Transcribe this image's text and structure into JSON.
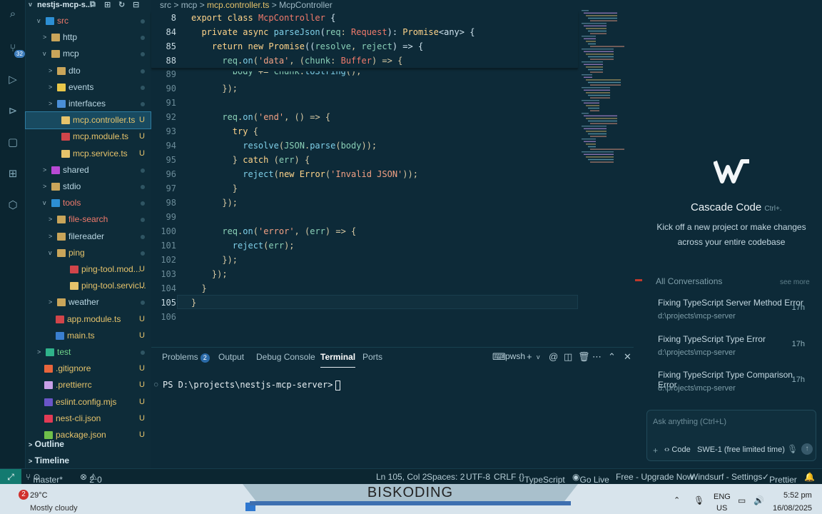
{
  "explorer": {
    "project": "nestjs-mcp-s...",
    "items": [
      {
        "label": "src",
        "status": "",
        "chev": "v",
        "color": "#f07a6b",
        "icon": "#2d8fd4"
      },
      {
        "label": "http",
        "status": "",
        "chev": ">",
        "color": "#b9d6e2",
        "icon": "#c9a55a"
      },
      {
        "label": "mcp",
        "status": "",
        "chev": "v",
        "color": "#b9d6e2",
        "icon": "#c9a55a"
      },
      {
        "label": "dto",
        "status": "",
        "chev": ">",
        "color": "#b9d6e2",
        "icon": "#c9a55a"
      },
      {
        "label": "events",
        "status": "",
        "chev": ">",
        "color": "#b9d6e2",
        "icon": "#e8c74a"
      },
      {
        "label": "interfaces",
        "status": "",
        "chev": ">",
        "color": "#b9d6e2",
        "icon": "#4a8fd8"
      },
      {
        "label": "mcp.controller.ts",
        "status": "U",
        "chev": "",
        "color": "#e6c36b",
        "icon": "#e6c36b",
        "selected": true
      },
      {
        "label": "mcp.module.ts",
        "status": "U",
        "chev": "",
        "color": "#e6c36b",
        "icon": "#d1454a"
      },
      {
        "label": "mcp.service.ts",
        "status": "U",
        "chev": "",
        "color": "#e6c36b",
        "icon": "#e6c36b"
      },
      {
        "label": "shared",
        "status": "",
        "chev": ">",
        "color": "#b9d6e2",
        "icon": "#b84ad4"
      },
      {
        "label": "stdio",
        "status": "",
        "chev": ">",
        "color": "#b9d6e2",
        "icon": "#c9a55a"
      },
      {
        "label": "tools",
        "status": "",
        "chev": "v",
        "color": "#f07a6b",
        "icon": "#2d8fd4"
      },
      {
        "label": "file-search",
        "status": "",
        "chev": ">",
        "color": "#f07a6b",
        "icon": "#c9a55a"
      },
      {
        "label": "filereader",
        "status": "",
        "chev": ">",
        "color": "#b9d6e2",
        "icon": "#c9a55a"
      },
      {
        "label": "ping",
        "status": "",
        "chev": "v",
        "color": "#e6c36b",
        "icon": "#c9a55a"
      },
      {
        "label": "ping-tool.mod...",
        "status": "U",
        "chev": "",
        "color": "#e6c36b",
        "icon": "#d1454a"
      },
      {
        "label": "ping-tool.servic...",
        "status": "U",
        "chev": "",
        "color": "#e6c36b",
        "icon": "#e6c36b"
      },
      {
        "label": "weather",
        "status": "",
        "chev": ">",
        "color": "#b9d6e2",
        "icon": "#c9a55a"
      },
      {
        "label": "app.module.ts",
        "status": "U",
        "chev": "",
        "color": "#e6c36b",
        "icon": "#d1454a"
      },
      {
        "label": "main.ts",
        "status": "U",
        "chev": "",
        "color": "#e6c36b",
        "icon": "#3a7fcf"
      },
      {
        "label": "test",
        "status": "",
        "chev": ">",
        "color": "#6fd48a",
        "icon": "#2fb38a"
      },
      {
        "label": ".gitignore",
        "status": "U",
        "chev": "",
        "color": "#e6c36b",
        "icon": "#e8653c"
      },
      {
        "label": ".prettierrc",
        "status": "U",
        "chev": "",
        "color": "#e6c36b",
        "icon": "#c8a0e8"
      },
      {
        "label": "eslint.config.mjs",
        "status": "U",
        "chev": "",
        "color": "#e6c36b",
        "icon": "#6a55c8"
      },
      {
        "label": "nest-cli.json",
        "status": "U",
        "chev": "",
        "color": "#e6c36b",
        "icon": "#e23b55"
      },
      {
        "label": "package.json",
        "status": "U",
        "chev": "",
        "color": "#e6c36b",
        "icon": "#6fbf4a"
      }
    ],
    "outline": "Outline",
    "timeline": "Timeline"
  },
  "breadcrumb": {
    "parts": [
      "src",
      "mcp",
      "mcp.controller.ts",
      "McpController"
    ],
    "sep": ">"
  },
  "code": [
    {
      "n": "8",
      "html": "<span class='kw'>export</span> <span class='kw'>class</span> <span class='cls'>McpController</span> <span class='pl'>{</span>",
      "sticky": true
    },
    {
      "n": "84",
      "html": "  <span class='kw'>private</span> <span class='kw'>async</span> <span class='fn'>parseJson</span><span class='pl'>(</span><span class='pm'>req</span>: <span class='cls'>Request</span><span class='pl'>):</span> <span class='kw'>Promise</span><span class='pl'>&lt;any&gt; {</span>",
      "sticky": true
    },
    {
      "n": "85",
      "html": "    <span class='kw'>return</span> <span class='kw'>new</span> <span class='kw'>Promise</span><span class='pl'>((</span><span class='pm'>resolve</span>, <span class='pm'>reject</span><span class='pl'>) =&gt; {</span>",
      "sticky": true
    },
    {
      "n": "88",
      "html": "      <span class='pm'>req</span>.<span class='fn'>on</span>(<span class='st2'>'data'</span>, (<span class='pm'>chunk</span>: <span class='cls'>Buffer</span>) =&gt; {",
      "sticky": true
    },
    {
      "n": "89",
      "html": "        <span class='pm'>body</span> += <span class='pm'>chunk</span>.<span class='fn'>toString</span>();"
    },
    {
      "n": "90",
      "html": "      });"
    },
    {
      "n": "91",
      "html": ""
    },
    {
      "n": "92",
      "html": "      <span class='pm'>req</span>.<span class='fn'>on</span>(<span class='st2'>'end'</span>, () =&gt; {"
    },
    {
      "n": "93",
      "html": "        <span class='kw'>try</span> {"
    },
    {
      "n": "94",
      "html": "          <span class='fn'>resolve</span>(<span class='pm'>JSON</span>.<span class='fn'>parse</span>(<span class='pm'>body</span>));"
    },
    {
      "n": "95",
      "html": "        } <span class='kw'>catch</span> (<span class='pm'>err</span>) {"
    },
    {
      "n": "96",
      "html": "          <span class='fn'>reject</span>(<span class='kw'>new</span> <span class='kw'>Error</span>(<span class='st2'>'Invalid JSON'</span>));"
    },
    {
      "n": "97",
      "html": "        }"
    },
    {
      "n": "98",
      "html": "      });"
    },
    {
      "n": "99",
      "html": ""
    },
    {
      "n": "100",
      "html": "      <span class='pm'>req</span>.<span class='fn'>on</span>(<span class='st2'>'error'</span>, (<span class='pm'>err</span>) =&gt; {"
    },
    {
      "n": "101",
      "html": "        <span class='fn'>reject</span>(<span class='pm'>err</span>);"
    },
    {
      "n": "102",
      "html": "      });"
    },
    {
      "n": "103",
      "html": "    });"
    },
    {
      "n": "104",
      "html": "  }"
    },
    {
      "n": "105",
      "html": "}"
    },
    {
      "n": "106",
      "html": ""
    }
  ],
  "panel": {
    "tabs": [
      "Problems",
      "Output",
      "Debug Console",
      "Terminal",
      "Ports"
    ],
    "problems_count": "2",
    "active": "Terminal",
    "shell": "pwsh",
    "prompt": "PS D:\\projects\\nestjs-mcp-server>"
  },
  "cascade": {
    "title": "Cascade Code",
    "shortcut": "Ctrl+.",
    "subtitle1": "Kick off a new project or make changes",
    "subtitle2": "across your entire codebase",
    "all_conversations": "All Conversations",
    "see_more": "see more",
    "conversations": [
      {
        "title": "Fixing TypeScript Server Method Error",
        "path": "d:\\projects\\mcp-server",
        "time": "17h"
      },
      {
        "title": "Fixing TypeScript Type Error",
        "path": "d:\\projects\\mcp-server",
        "time": "17h"
      },
      {
        "title": "Fixing TypeScript Type Comparison Error",
        "path": "d:\\projects\\mcp-server",
        "time": "17h"
      }
    ],
    "input_placeholder": "Ask anything (Ctrl+L)",
    "mode": "Code",
    "model": "SWE-1 (free limited time)"
  },
  "status": {
    "branch": "master*",
    "errors": "2",
    "warnings": "0",
    "position": "Ln 105, Col 2",
    "spaces": "Spaces: 2",
    "encoding": "UTF-8",
    "eol": "CRLF",
    "language": "TypeScript",
    "golive": "Go Live",
    "upgrade": "Free - Upgrade Now",
    "windsurf": "Windsurf - Settings",
    "prettier": "Prettier"
  },
  "taskbar": {
    "title": "BISKODING",
    "weather_badge": "2",
    "temp": "29°C",
    "weather": "Mostly cloudy",
    "lang1": "ENG",
    "lang2": "US",
    "time": "5:52 pm",
    "date": "16/08/2025"
  }
}
